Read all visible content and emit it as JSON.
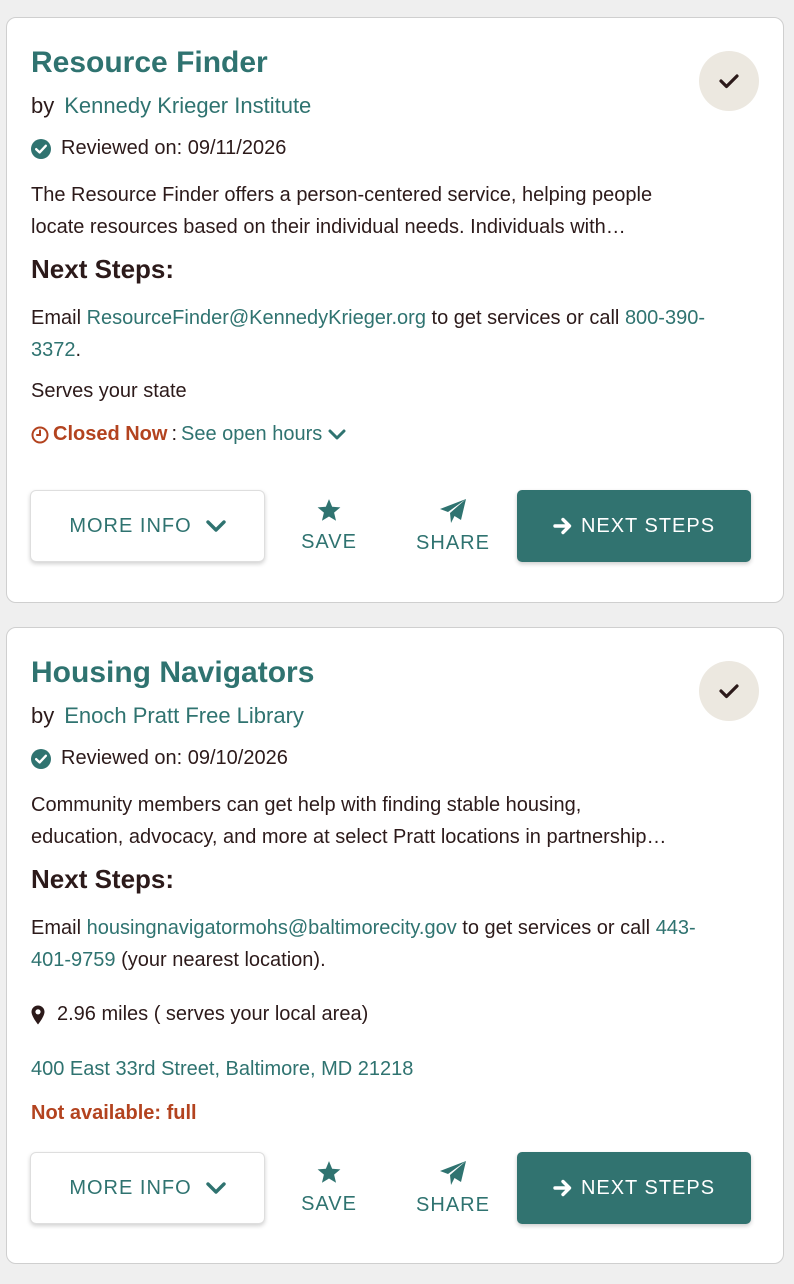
{
  "colors": {
    "accent": "#2f7370",
    "button_fill": "#317370",
    "alert": "#b3431f",
    "text": "#2c1a1a"
  },
  "cards": [
    {
      "title": "Resource Finder",
      "by_label": "by",
      "organization": "Kennedy Krieger Institute",
      "reviewed": "Reviewed on: 09/11/2026",
      "description_line1": "The Resource Finder offers a person-centered service, helping people",
      "description_line2": "locate resources based on their individual needs. Individuals with…",
      "next_steps_heading": "Next Steps:",
      "steps_prefix": "Email",
      "email": "ResourceFinder@KennedyKrieger.org",
      "steps_middle": "to get services or call",
      "phone_part1": "800-390-",
      "phone_part2": "3372",
      "steps_suffix": ".",
      "serves": "Serves your state",
      "closed_label": "Closed Now",
      "hours_separator": ":",
      "hours_link": "See open hours",
      "more_info": "MORE INFO",
      "save": "SAVE",
      "share": "SHARE",
      "next_steps_button": "NEXT STEPS"
    },
    {
      "title": "Housing Navigators",
      "by_label": "by",
      "organization": "Enoch Pratt Free Library",
      "reviewed": "Reviewed on: 09/10/2026",
      "description_line1": "Community members can get help with finding stable housing,",
      "description_line2": "education, advocacy, and more at select Pratt locations in partnership…",
      "next_steps_heading": "Next Steps:",
      "steps_prefix": "Email",
      "email": "housingnavigatormohs@baltimorecity.gov",
      "steps_middle": "to get services or call",
      "phone_part1": "443-",
      "phone_part2": "401-9759",
      "steps_suffix": "(your nearest location).",
      "distance": "2.96 miles ( serves your local area)",
      "address": "400 East 33rd Street, Baltimore, MD 21218",
      "availability": "Not available: full",
      "more_info": "MORE INFO",
      "save": "SAVE",
      "share": "SHARE",
      "next_steps_button": "NEXT STEPS"
    }
  ]
}
